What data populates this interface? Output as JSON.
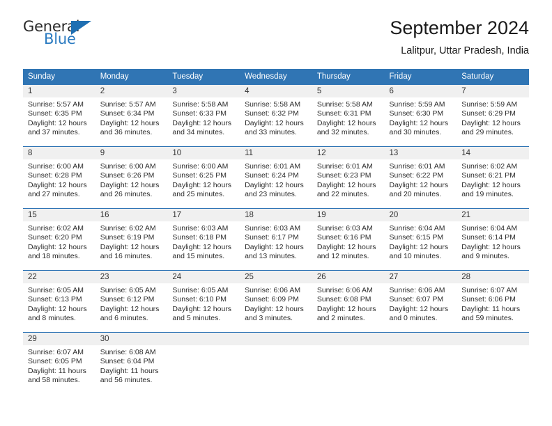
{
  "brand": {
    "name_part1": "General",
    "name_part2": "Blue",
    "logo_icon": "blue-triangle-icon"
  },
  "header": {
    "title": "September 2024",
    "subtitle": "Lalitpur, Uttar Pradesh, India"
  },
  "calendar": {
    "weekday_headers": [
      "Sunday",
      "Monday",
      "Tuesday",
      "Wednesday",
      "Thursday",
      "Friday",
      "Saturday"
    ],
    "accent_color": "#3075b4",
    "daynum_bg": "#f0f0f0",
    "weeks": [
      [
        {
          "day": "1",
          "sunrise": "Sunrise: 5:57 AM",
          "sunset": "Sunset: 6:35 PM",
          "daylight_line1": "Daylight: 12 hours",
          "daylight_line2": "and 37 minutes."
        },
        {
          "day": "2",
          "sunrise": "Sunrise: 5:57 AM",
          "sunset": "Sunset: 6:34 PM",
          "daylight_line1": "Daylight: 12 hours",
          "daylight_line2": "and 36 minutes."
        },
        {
          "day": "3",
          "sunrise": "Sunrise: 5:58 AM",
          "sunset": "Sunset: 6:33 PM",
          "daylight_line1": "Daylight: 12 hours",
          "daylight_line2": "and 34 minutes."
        },
        {
          "day": "4",
          "sunrise": "Sunrise: 5:58 AM",
          "sunset": "Sunset: 6:32 PM",
          "daylight_line1": "Daylight: 12 hours",
          "daylight_line2": "and 33 minutes."
        },
        {
          "day": "5",
          "sunrise": "Sunrise: 5:58 AM",
          "sunset": "Sunset: 6:31 PM",
          "daylight_line1": "Daylight: 12 hours",
          "daylight_line2": "and 32 minutes."
        },
        {
          "day": "6",
          "sunrise": "Sunrise: 5:59 AM",
          "sunset": "Sunset: 6:30 PM",
          "daylight_line1": "Daylight: 12 hours",
          "daylight_line2": "and 30 minutes."
        },
        {
          "day": "7",
          "sunrise": "Sunrise: 5:59 AM",
          "sunset": "Sunset: 6:29 PM",
          "daylight_line1": "Daylight: 12 hours",
          "daylight_line2": "and 29 minutes."
        }
      ],
      [
        {
          "day": "8",
          "sunrise": "Sunrise: 6:00 AM",
          "sunset": "Sunset: 6:28 PM",
          "daylight_line1": "Daylight: 12 hours",
          "daylight_line2": "and 27 minutes."
        },
        {
          "day": "9",
          "sunrise": "Sunrise: 6:00 AM",
          "sunset": "Sunset: 6:26 PM",
          "daylight_line1": "Daylight: 12 hours",
          "daylight_line2": "and 26 minutes."
        },
        {
          "day": "10",
          "sunrise": "Sunrise: 6:00 AM",
          "sunset": "Sunset: 6:25 PM",
          "daylight_line1": "Daylight: 12 hours",
          "daylight_line2": "and 25 minutes."
        },
        {
          "day": "11",
          "sunrise": "Sunrise: 6:01 AM",
          "sunset": "Sunset: 6:24 PM",
          "daylight_line1": "Daylight: 12 hours",
          "daylight_line2": "and 23 minutes."
        },
        {
          "day": "12",
          "sunrise": "Sunrise: 6:01 AM",
          "sunset": "Sunset: 6:23 PM",
          "daylight_line1": "Daylight: 12 hours",
          "daylight_line2": "and 22 minutes."
        },
        {
          "day": "13",
          "sunrise": "Sunrise: 6:01 AM",
          "sunset": "Sunset: 6:22 PM",
          "daylight_line1": "Daylight: 12 hours",
          "daylight_line2": "and 20 minutes."
        },
        {
          "day": "14",
          "sunrise": "Sunrise: 6:02 AM",
          "sunset": "Sunset: 6:21 PM",
          "daylight_line1": "Daylight: 12 hours",
          "daylight_line2": "and 19 minutes."
        }
      ],
      [
        {
          "day": "15",
          "sunrise": "Sunrise: 6:02 AM",
          "sunset": "Sunset: 6:20 PM",
          "daylight_line1": "Daylight: 12 hours",
          "daylight_line2": "and 18 minutes."
        },
        {
          "day": "16",
          "sunrise": "Sunrise: 6:02 AM",
          "sunset": "Sunset: 6:19 PM",
          "daylight_line1": "Daylight: 12 hours",
          "daylight_line2": "and 16 minutes."
        },
        {
          "day": "17",
          "sunrise": "Sunrise: 6:03 AM",
          "sunset": "Sunset: 6:18 PM",
          "daylight_line1": "Daylight: 12 hours",
          "daylight_line2": "and 15 minutes."
        },
        {
          "day": "18",
          "sunrise": "Sunrise: 6:03 AM",
          "sunset": "Sunset: 6:17 PM",
          "daylight_line1": "Daylight: 12 hours",
          "daylight_line2": "and 13 minutes."
        },
        {
          "day": "19",
          "sunrise": "Sunrise: 6:03 AM",
          "sunset": "Sunset: 6:16 PM",
          "daylight_line1": "Daylight: 12 hours",
          "daylight_line2": "and 12 minutes."
        },
        {
          "day": "20",
          "sunrise": "Sunrise: 6:04 AM",
          "sunset": "Sunset: 6:15 PM",
          "daylight_line1": "Daylight: 12 hours",
          "daylight_line2": "and 10 minutes."
        },
        {
          "day": "21",
          "sunrise": "Sunrise: 6:04 AM",
          "sunset": "Sunset: 6:14 PM",
          "daylight_line1": "Daylight: 12 hours",
          "daylight_line2": "and 9 minutes."
        }
      ],
      [
        {
          "day": "22",
          "sunrise": "Sunrise: 6:05 AM",
          "sunset": "Sunset: 6:13 PM",
          "daylight_line1": "Daylight: 12 hours",
          "daylight_line2": "and 8 minutes."
        },
        {
          "day": "23",
          "sunrise": "Sunrise: 6:05 AM",
          "sunset": "Sunset: 6:12 PM",
          "daylight_line1": "Daylight: 12 hours",
          "daylight_line2": "and 6 minutes."
        },
        {
          "day": "24",
          "sunrise": "Sunrise: 6:05 AM",
          "sunset": "Sunset: 6:10 PM",
          "daylight_line1": "Daylight: 12 hours",
          "daylight_line2": "and 5 minutes."
        },
        {
          "day": "25",
          "sunrise": "Sunrise: 6:06 AM",
          "sunset": "Sunset: 6:09 PM",
          "daylight_line1": "Daylight: 12 hours",
          "daylight_line2": "and 3 minutes."
        },
        {
          "day": "26",
          "sunrise": "Sunrise: 6:06 AM",
          "sunset": "Sunset: 6:08 PM",
          "daylight_line1": "Daylight: 12 hours",
          "daylight_line2": "and 2 minutes."
        },
        {
          "day": "27",
          "sunrise": "Sunrise: 6:06 AM",
          "sunset": "Sunset: 6:07 PM",
          "daylight_line1": "Daylight: 12 hours",
          "daylight_line2": "and 0 minutes."
        },
        {
          "day": "28",
          "sunrise": "Sunrise: 6:07 AM",
          "sunset": "Sunset: 6:06 PM",
          "daylight_line1": "Daylight: 11 hours",
          "daylight_line2": "and 59 minutes."
        }
      ],
      [
        {
          "day": "29",
          "sunrise": "Sunrise: 6:07 AM",
          "sunset": "Sunset: 6:05 PM",
          "daylight_line1": "Daylight: 11 hours",
          "daylight_line2": "and 58 minutes."
        },
        {
          "day": "30",
          "sunrise": "Sunrise: 6:08 AM",
          "sunset": "Sunset: 6:04 PM",
          "daylight_line1": "Daylight: 11 hours",
          "daylight_line2": "and 56 minutes."
        },
        {
          "day": "",
          "sunrise": "",
          "sunset": "",
          "daylight_line1": "",
          "daylight_line2": ""
        },
        {
          "day": "",
          "sunrise": "",
          "sunset": "",
          "daylight_line1": "",
          "daylight_line2": ""
        },
        {
          "day": "",
          "sunrise": "",
          "sunset": "",
          "daylight_line1": "",
          "daylight_line2": ""
        },
        {
          "day": "",
          "sunrise": "",
          "sunset": "",
          "daylight_line1": "",
          "daylight_line2": ""
        },
        {
          "day": "",
          "sunrise": "",
          "sunset": "",
          "daylight_line1": "",
          "daylight_line2": ""
        }
      ]
    ]
  }
}
